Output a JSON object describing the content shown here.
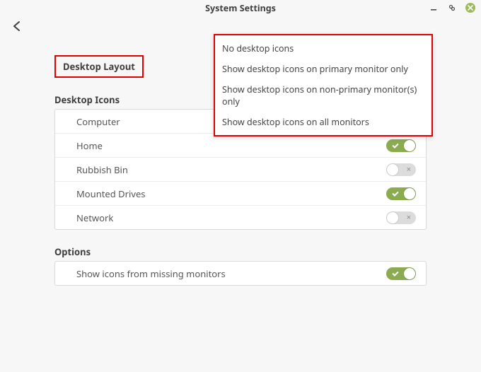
{
  "window": {
    "title": "System Settings"
  },
  "page": {
    "header": "Desktop Layout",
    "sections": {
      "icons_header": "Desktop Icons",
      "options_header": "Options"
    }
  },
  "layout_dropdown": {
    "options": [
      "No desktop icons",
      "Show desktop icons on primary monitor only",
      "Show desktop icons on non-primary monitor(s) only",
      "Show desktop icons on all monitors"
    ]
  },
  "desktop_icons": [
    {
      "label": "Computer",
      "enabled": null
    },
    {
      "label": "Home",
      "enabled": true
    },
    {
      "label": "Rubbish Bin",
      "enabled": false
    },
    {
      "label": "Mounted Drives",
      "enabled": true
    },
    {
      "label": "Network",
      "enabled": false
    }
  ],
  "options": [
    {
      "label": "Show icons from missing monitors",
      "enabled": true
    }
  ]
}
